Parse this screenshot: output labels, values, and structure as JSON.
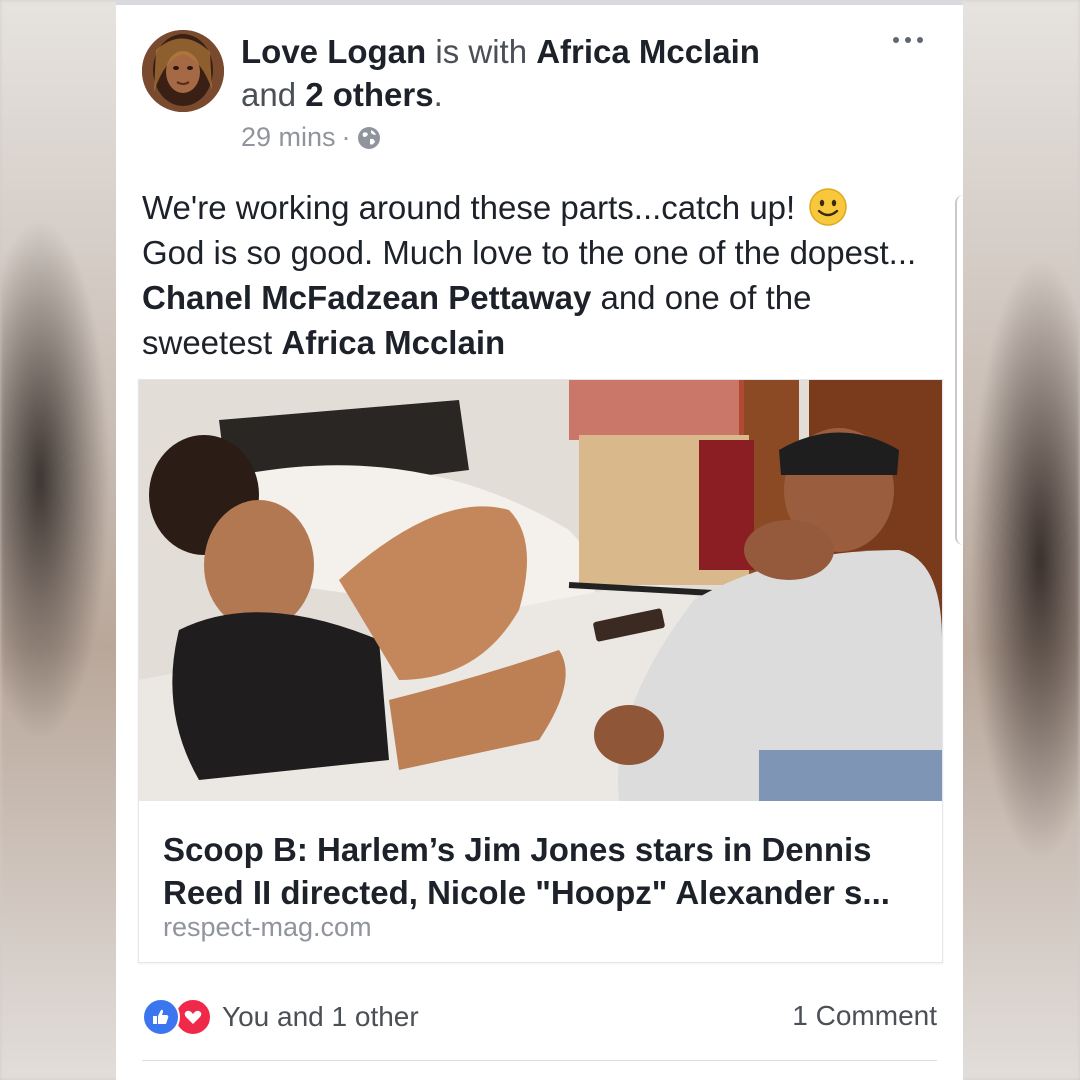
{
  "post": {
    "author": "Love Logan",
    "connector_with": " is with ",
    "tagged_person": "Africa Mcclain",
    "connector_and": "and ",
    "others": "2 others",
    "period": ".",
    "time": "29 mins",
    "separator": "·",
    "privacy_icon": "globe-icon",
    "text_part1": "We're working around these parts...catch up! ",
    "text_part2": "God is so good. Much love to the one of the dopest... ",
    "mention1": "Chanel McFadzean Pettaway",
    "text_part3": " and one of the sweetest ",
    "mention2": "Africa Mcclain"
  },
  "link_preview": {
    "title": "Scoop B: Harlem’s Jim Jones stars in Dennis Reed II directed, Nicole \"Hoopz\" Alexander s...",
    "domain": "respect-mag.com"
  },
  "footer": {
    "reactions_text": "You and 1 other",
    "comments_text": "1 Comment"
  },
  "colors": {
    "like_blue": "#3b75f0",
    "love_red": "#f0284a",
    "text_primary": "#1d2129",
    "text_secondary": "#90949c"
  }
}
